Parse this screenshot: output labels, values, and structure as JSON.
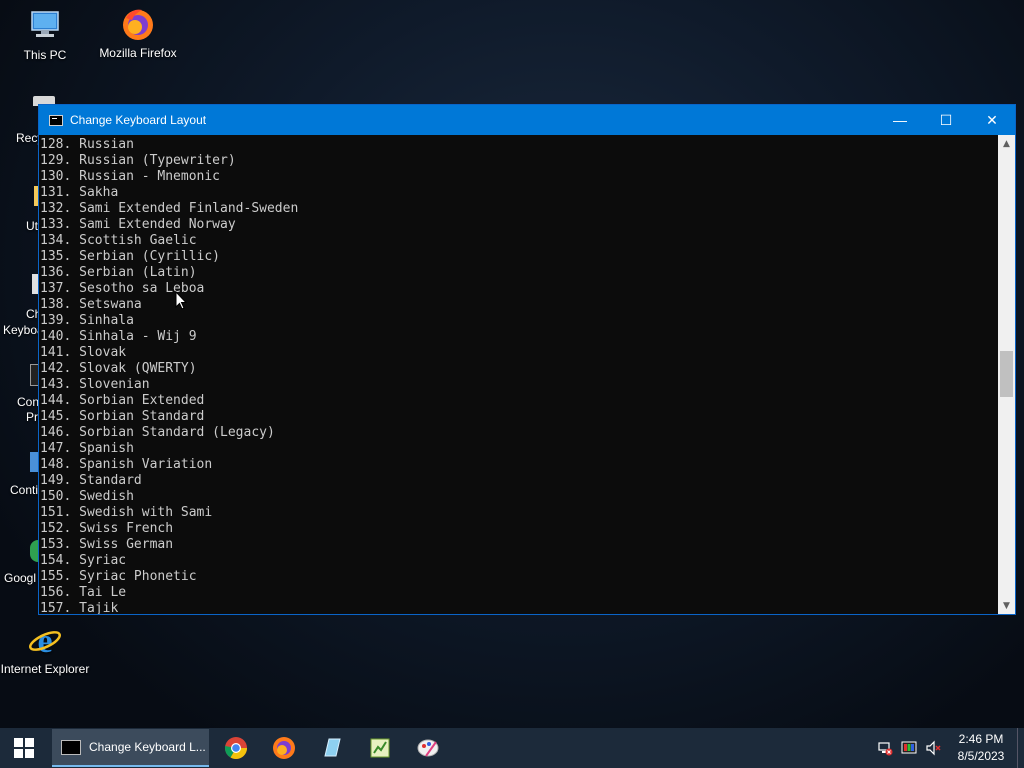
{
  "desktop": {
    "icons": [
      {
        "label": "This PC"
      },
      {
        "label": "Mozilla Firefox"
      },
      {
        "label": "Internet Explorer"
      }
    ],
    "partial_labels": [
      "Recy",
      "Ut",
      "Ch",
      "Keyboa",
      "Con",
      "Pr",
      "Conti",
      "Googl"
    ]
  },
  "window": {
    "title": "Change Keyboard Layout",
    "minimize": "—",
    "maximize": "☐",
    "close": "✕"
  },
  "console": {
    "lines": [
      "128. Russian",
      "129. Russian (Typewriter)",
      "130. Russian - Mnemonic",
      "131. Sakha",
      "132. Sami Extended Finland-Sweden",
      "133. Sami Extended Norway",
      "134. Scottish Gaelic",
      "135. Serbian (Cyrillic)",
      "136. Serbian (Latin)",
      "137. Sesotho sa Leboa",
      "138. Setswana",
      "139. Sinhala",
      "140. Sinhala - Wij 9",
      "141. Slovak",
      "142. Slovak (QWERTY)",
      "143. Slovenian",
      "144. Sorbian Extended",
      "145. Sorbian Standard",
      "146. Sorbian Standard (Legacy)",
      "147. Spanish",
      "148. Spanish Variation",
      "149. Standard",
      "150. Swedish",
      "151. Swedish with Sami",
      "152. Swiss French",
      "153. Swiss German",
      "154. Syriac",
      "155. Syriac Phonetic",
      "156. Tai Le",
      "157. Tajik"
    ]
  },
  "taskbar": {
    "active_task": "Change Keyboard L...",
    "pinned": [
      "chrome-icon",
      "firefox-icon",
      "files-icon",
      "notepad-icon",
      "paint-icon"
    ],
    "clock_time": "2:46 PM",
    "clock_date": "8/5/2023"
  },
  "colors": {
    "titlebar": "#0078d7",
    "console_bg": "#0c0c0c",
    "console_text": "#cccccc",
    "taskbar": "#1c2a3a"
  }
}
